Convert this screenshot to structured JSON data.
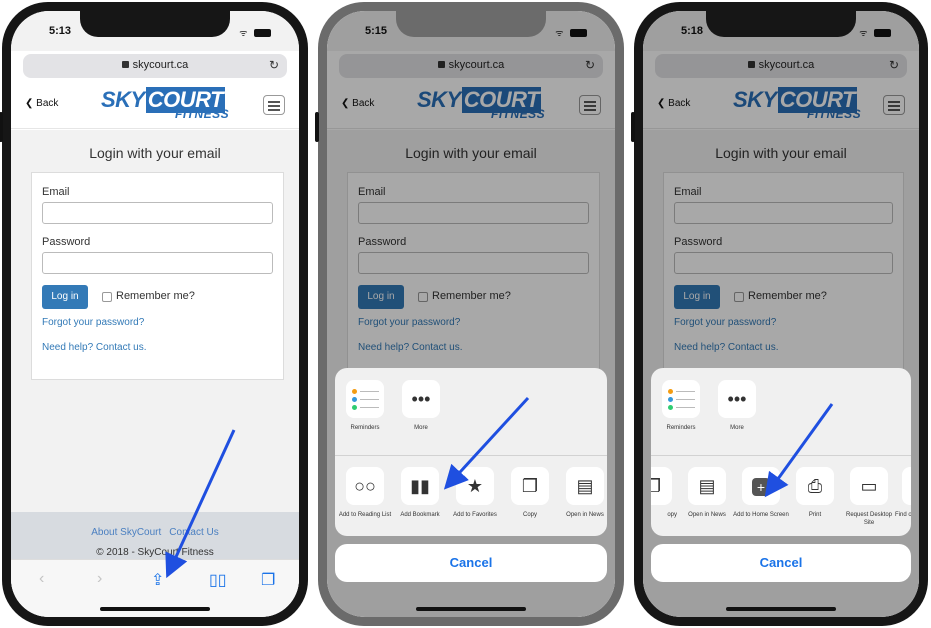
{
  "colors": {
    "accent": "#1a73e8",
    "brand": "#2a6fb8",
    "link": "#337ab7",
    "arrow": "#1f4fe0"
  },
  "phones": [
    {
      "time": "5:13"
    },
    {
      "time": "5:15"
    },
    {
      "time": "5:18"
    }
  ],
  "browser": {
    "url": "skycourt.ca",
    "reload_icon": "reload-icon",
    "back_label": "Back"
  },
  "logo": {
    "main": "SKY",
    "court": "COURT",
    "sub": "FITNESS"
  },
  "login": {
    "title": "Login with your email",
    "email_label": "Email",
    "password_label": "Password",
    "login_button": "Log in",
    "remember_label": "Remember me?",
    "forgot_link": "Forgot your password?",
    "help_link": "Need help? Contact us."
  },
  "footer": {
    "about_link": "About SkyCourt",
    "contact_link": "Contact Us",
    "copyright": "© 2018 - SkyCourt Fitness"
  },
  "toolbar": {
    "icons": [
      "back-icon",
      "forward-icon",
      "share-icon",
      "bookmarks-icon",
      "tabs-icon"
    ]
  },
  "share_sheet": {
    "row1": [
      {
        "label": "Reminders",
        "icon": "reminders-icon"
      },
      {
        "label": "More",
        "icon": "more-icon"
      }
    ],
    "row2_phone2": [
      {
        "label": "Add to Reading List",
        "icon": "reading-list-icon"
      },
      {
        "label": "Add Bookmark",
        "icon": "bookmark-icon"
      },
      {
        "label": "Add to Favorites",
        "icon": "star-icon"
      },
      {
        "label": "Copy",
        "icon": "copy-icon"
      },
      {
        "label": "Open in News",
        "icon": "news-icon"
      }
    ],
    "row2_phone3": [
      {
        "label": "opy",
        "icon": "copy-icon"
      },
      {
        "label": "Open in News",
        "icon": "news-icon"
      },
      {
        "label": "Add to Home Screen",
        "icon": "add-to-home-icon"
      },
      {
        "label": "Print",
        "icon": "print-icon"
      },
      {
        "label": "Request Desktop Site",
        "icon": "desktop-icon"
      },
      {
        "label": "Find o",
        "icon": "find-icon"
      }
    ],
    "cancel": "Cancel"
  }
}
